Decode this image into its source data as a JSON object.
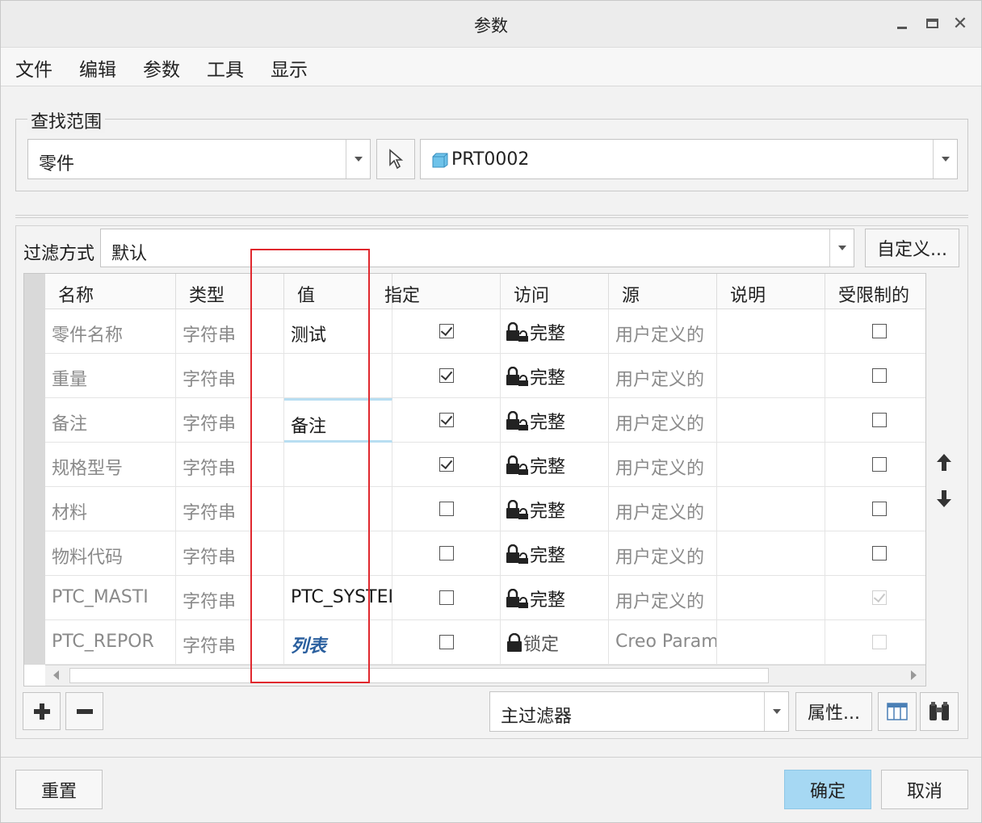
{
  "window": {
    "title": "参数"
  },
  "menu": [
    "文件",
    "编辑",
    "参数",
    "工具",
    "显示"
  ],
  "find_scope": {
    "label": "查找范围",
    "scope_value": "零件",
    "target_value": "PRT0002"
  },
  "filter": {
    "label": "过滤方式",
    "value": "默认",
    "customize_label": "自定义..."
  },
  "table": {
    "headers": [
      "名称",
      "类型",
      "值",
      "指定",
      "访问",
      "源",
      "说明",
      "受限制的"
    ],
    "rows": [
      {
        "name": "零件名称",
        "type": "字符串",
        "value": "测试",
        "designate": true,
        "access": "完整",
        "source": "用户定义的",
        "desc": "",
        "restricted": false,
        "restricted_disabled": false
      },
      {
        "name": "重量",
        "type": "字符串",
        "value": "",
        "designate": true,
        "access": "完整",
        "source": "用户定义的",
        "desc": "",
        "restricted": false,
        "restricted_disabled": false
      },
      {
        "name": "备注",
        "type": "字符串",
        "value": "备注",
        "designate": true,
        "access": "完整",
        "source": "用户定义的",
        "desc": "",
        "restricted": false,
        "restricted_disabled": false
      },
      {
        "name": "规格型号",
        "type": "字符串",
        "value": "",
        "designate": true,
        "access": "完整",
        "source": "用户定义的",
        "desc": "",
        "restricted": false,
        "restricted_disabled": false
      },
      {
        "name": "材料",
        "type": "字符串",
        "value": "",
        "designate": false,
        "access": "完整",
        "source": "用户定义的",
        "desc": "",
        "restricted": false,
        "restricted_disabled": false
      },
      {
        "name": "物料代码",
        "type": "字符串",
        "value": "",
        "designate": false,
        "access": "完整",
        "source": "用户定义的",
        "desc": "",
        "restricted": false,
        "restricted_disabled": false
      },
      {
        "name": "PTC_MASTI",
        "type": "字符串",
        "value": "PTC_SYSTEI",
        "designate": false,
        "access": "完整",
        "source": "用户定义的",
        "desc": "",
        "restricted": true,
        "restricted_disabled": true
      },
      {
        "name": "PTC_REPOR",
        "type": "字符串",
        "value": "列表",
        "designate": false,
        "access": "锁定",
        "source": "Creo Param",
        "desc": "",
        "restricted": false,
        "restricted_disabled": true
      }
    ]
  },
  "bottom_toolbar": {
    "main_filter": "主过滤器",
    "properties_label": "属性..."
  },
  "footer": {
    "reset_label": "重置",
    "ok_label": "确定",
    "cancel_label": "取消"
  },
  "colors": {
    "ok_button": "#a6d8f3",
    "highlight": "#e0282e"
  }
}
